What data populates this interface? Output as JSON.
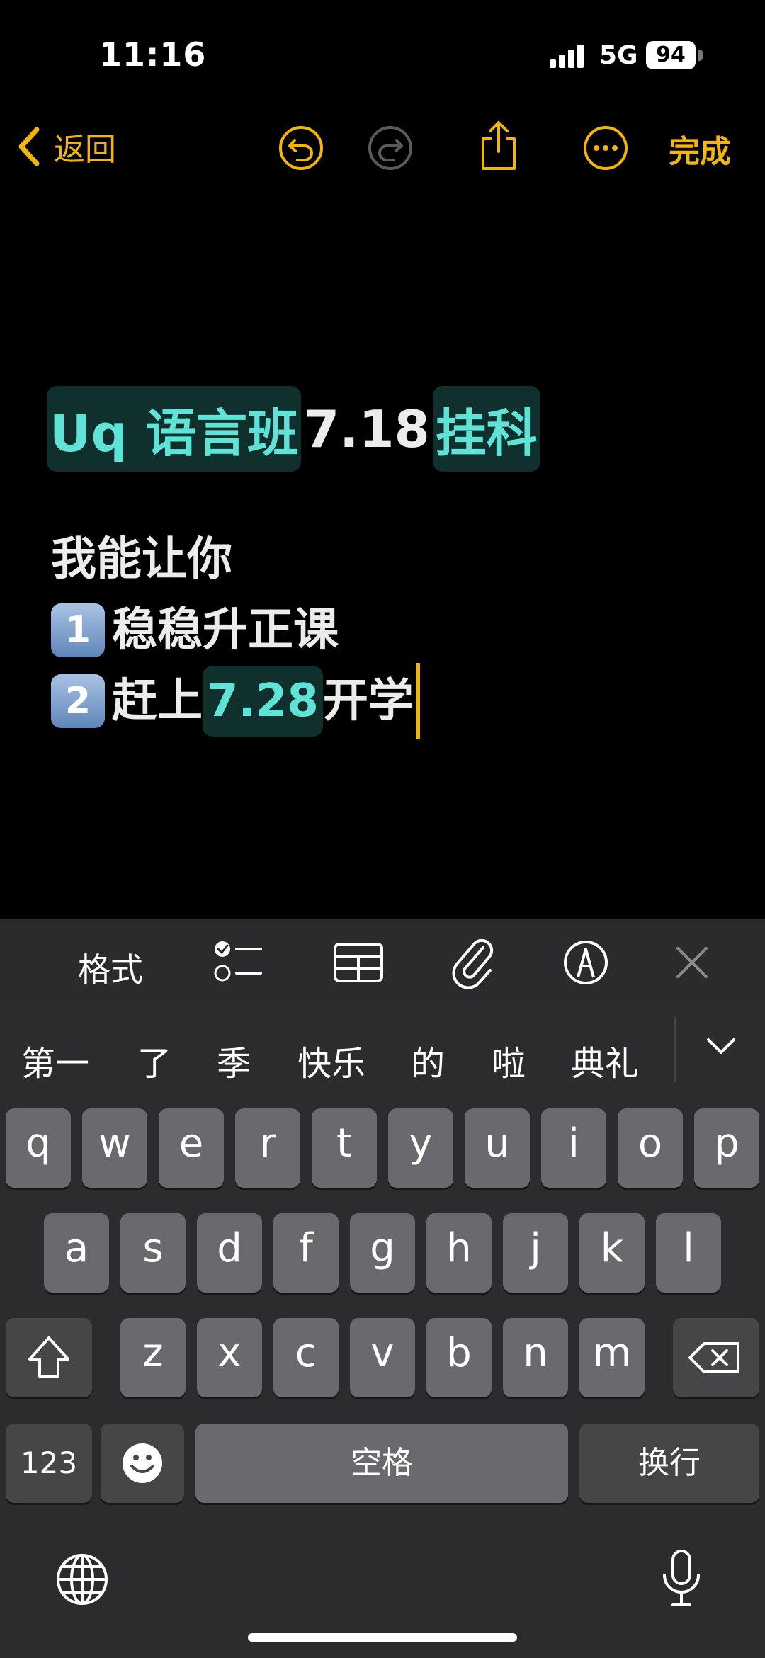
{
  "status_bar": {
    "time": "11:16",
    "network": "5G",
    "battery": "94"
  },
  "toolbar": {
    "back_label": "返回",
    "done_label": "完成"
  },
  "note": {
    "title_segments": [
      {
        "text": "Uq 语言班",
        "highlight": true
      },
      {
        "text": "7.18",
        "highlight": false
      },
      {
        "text": "挂科",
        "highlight": true
      }
    ],
    "line1": "我能让你",
    "line2_badge": "1",
    "line2": "稳稳升正课",
    "line3_badge": "2",
    "line3_a": "赶上",
    "line3_hl": "7.28",
    "line3_b": "开学"
  },
  "format_bar": {
    "format_label": "格式"
  },
  "candidates": [
    "第一",
    "了",
    "季",
    "快乐",
    "的",
    "啦",
    "典礼"
  ],
  "keyboard": {
    "row1": [
      "q",
      "w",
      "e",
      "r",
      "t",
      "y",
      "u",
      "i",
      "o",
      "p"
    ],
    "row2": [
      "a",
      "s",
      "d",
      "f",
      "g",
      "h",
      "j",
      "k",
      "l"
    ],
    "row3": [
      "z",
      "x",
      "c",
      "v",
      "b",
      "n",
      "m"
    ],
    "numbers_label": "123",
    "space_label": "空格",
    "return_label": "换行"
  },
  "colors": {
    "accent": "#f4b50a",
    "highlight_text": "#5fe3d6",
    "highlight_bg": "#10302d"
  }
}
